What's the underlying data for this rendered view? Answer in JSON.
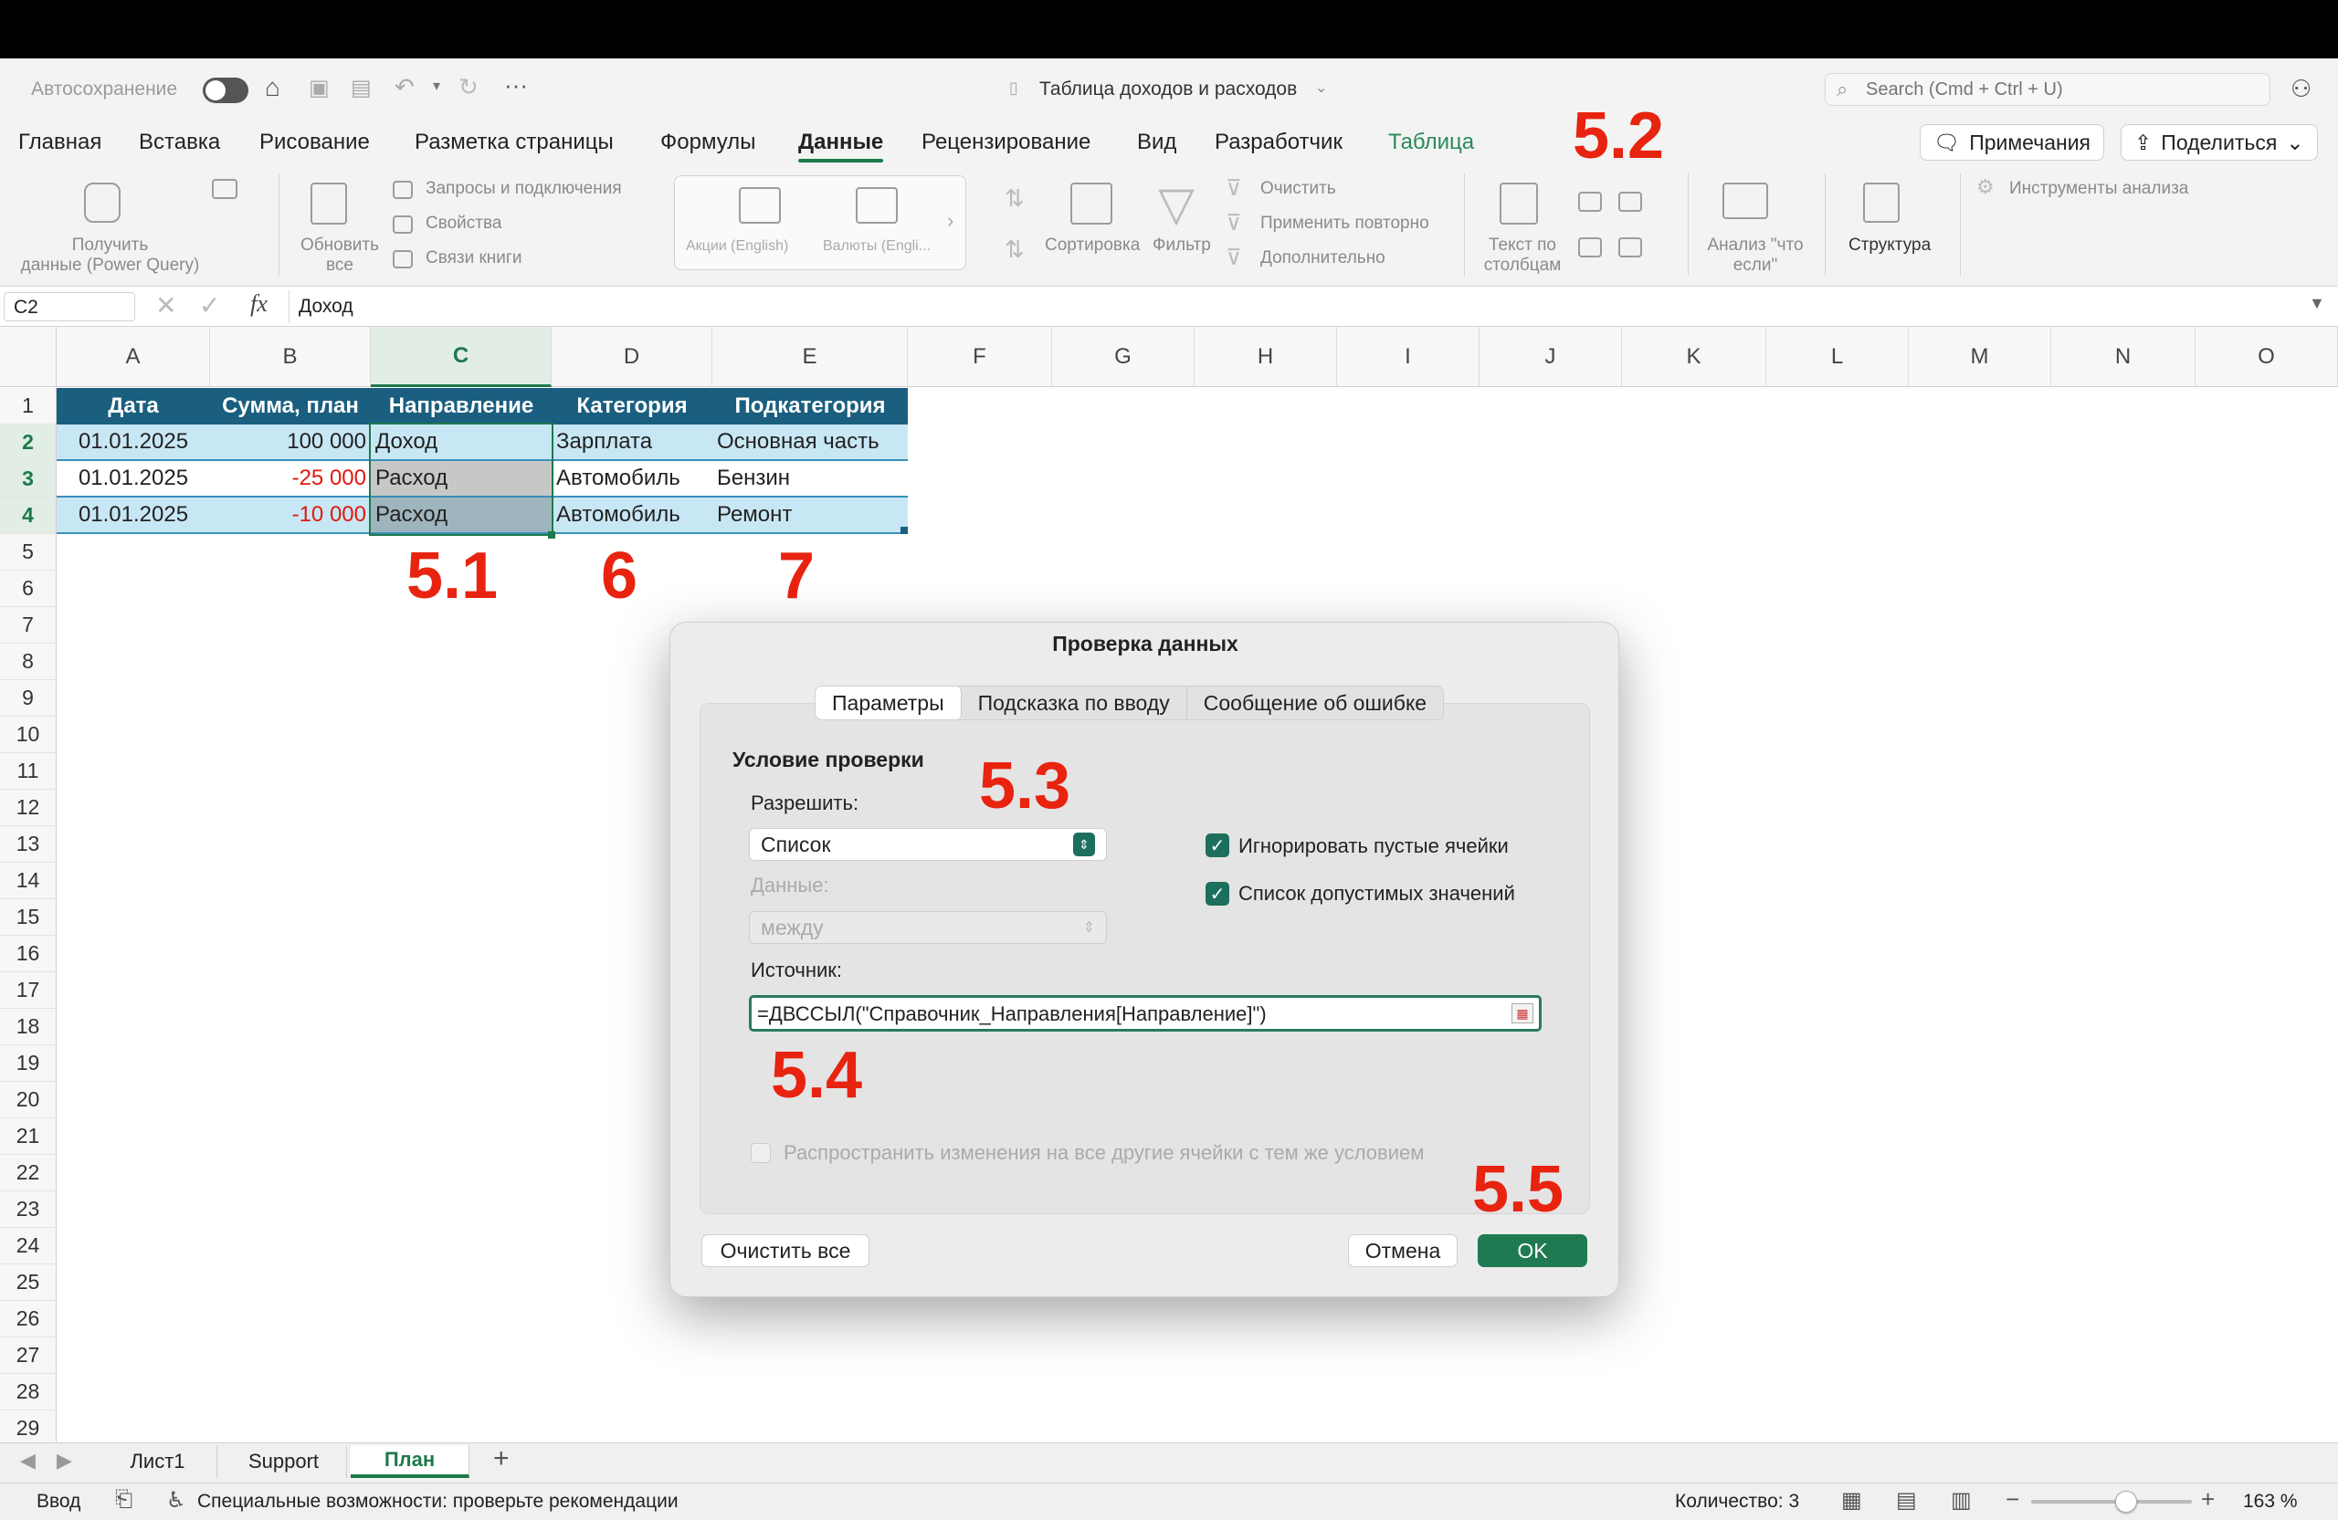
{
  "app": {
    "autosave_label": "Автосохранение",
    "doc_title": "Таблица доходов и расходов",
    "search_placeholder": "Search (Cmd + Ctrl + U)"
  },
  "ribbon_tabs": [
    "Главная",
    "Вставка",
    "Рисование",
    "Разметка страницы",
    "Формулы",
    "Данные",
    "Рецензирование",
    "Вид",
    "Разработчик",
    "Таблица"
  ],
  "active_tab": "Данные",
  "header_buttons": {
    "notes": "Примечания",
    "share": "Поделиться"
  },
  "ribbon": {
    "get_data": "Получить\nданные (Power Query)",
    "refresh_all": "Обновить\nвсе",
    "queries": "Запросы и подключения",
    "properties": "Свойства",
    "links": "Связи книги",
    "stocks": "Акции (English)",
    "currencies": "Валюты (Engli...",
    "sort": "Сортировка",
    "filter": "Фильтр",
    "clear": "Очистить",
    "reapply": "Применить повторно",
    "advanced": "Дополнительно",
    "text_to_columns": "Текст по\nстолбцам",
    "what_if": "Анализ \"что\nесли\"",
    "outline": "Структура",
    "analysis_tools": "Инструменты анализа"
  },
  "formula_bar": {
    "name_box": "C2",
    "fx": "fx",
    "value": "Доход"
  },
  "columns": [
    "A",
    "B",
    "C",
    "D",
    "E",
    "F",
    "G",
    "H",
    "I",
    "J",
    "K",
    "L",
    "M",
    "N",
    "O"
  ],
  "rows": [
    "1",
    "2",
    "3",
    "4",
    "5",
    "6",
    "7",
    "8",
    "9",
    "10",
    "11",
    "12",
    "13",
    "14",
    "15",
    "16",
    "17",
    "18",
    "19",
    "20",
    "21",
    "22",
    "23",
    "24",
    "25",
    "26",
    "27",
    "28",
    "29"
  ],
  "table": {
    "headers": [
      "Дата",
      "Сумма, план",
      "Направление",
      "Категория",
      "Подкатегория"
    ],
    "rows": [
      [
        "01.01.2025",
        "100 000",
        "Доход",
        "Зарплата",
        "Основная часть"
      ],
      [
        "01.01.2025",
        "-25 000",
        "Расход",
        "Автомобиль",
        "Бензин"
      ],
      [
        "01.01.2025",
        "-10 000",
        "Расход",
        "Автомобиль",
        "Ремонт"
      ]
    ]
  },
  "annotations": {
    "a51": "5.1",
    "a52": "5.2",
    "a53": "5.3",
    "a54": "5.4",
    "a55": "5.5",
    "a6": "6",
    "a7": "7"
  },
  "dialog": {
    "title": "Проверка данных",
    "tabs": [
      "Параметры",
      "Подсказка по вводу",
      "Сообщение об ошибке"
    ],
    "section": "Условие проверки",
    "allow_label": "Разрешить:",
    "allow_value": "Список",
    "data_label": "Данные:",
    "data_value": "между",
    "ignore_blank": "Игнорировать пустые ячейки",
    "in_cell_dropdown": "Список допустимых значений",
    "source_label": "Источник:",
    "source_value": "=ДВССЫЛ(\"Справочник_Направления[Направление]\")",
    "apply_all": "Распространить изменения на все другие ячейки с тем же условием",
    "clear_all": "Очистить все",
    "cancel": "Отмена",
    "ok": "OK"
  },
  "sheets": [
    "Лист1",
    "Support",
    "План"
  ],
  "active_sheet": "План",
  "status": {
    "mode": "Ввод",
    "accessibility": "Специальные возможности: проверьте рекомендации",
    "count": "Количество: 3",
    "zoom": "163 %"
  },
  "colors": {
    "accent": "#1d7a4a",
    "table_header": "#1a5e80",
    "table_row": "#c8e7f5",
    "annotation": "#e8230f"
  }
}
